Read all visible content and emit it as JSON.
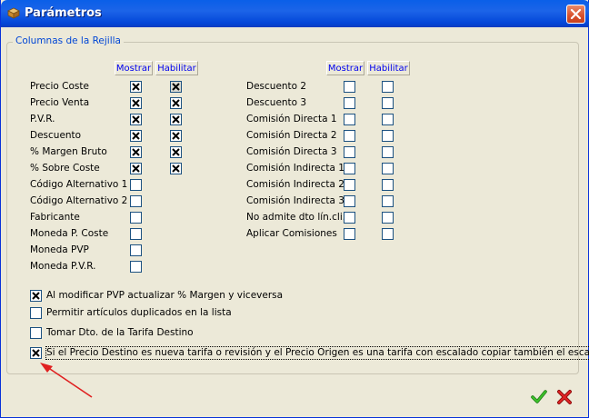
{
  "window": {
    "title": "Parámetros"
  },
  "group": {
    "legend": "Columnas de la Rejilla"
  },
  "left_headers": {
    "show": "Mostrar",
    "enable": "Habilitar"
  },
  "right_headers": {
    "show": "Mostrar",
    "enable": "Habilitar"
  },
  "left_rows": [
    {
      "label": "Precio Coste",
      "show": true,
      "enable": true
    },
    {
      "label": "Precio Venta",
      "show": true,
      "enable": true
    },
    {
      "label": "P.V.R.",
      "show": true,
      "enable": true
    },
    {
      "label": "Descuento",
      "show": true,
      "enable": true
    },
    {
      "label": "% Margen Bruto",
      "show": true,
      "enable": true
    },
    {
      "label": "% Sobre Coste",
      "show": true,
      "enable": true
    },
    {
      "label": "Código Alternativo 1",
      "show": false
    },
    {
      "label": "Código Alternativo 2",
      "show": false
    },
    {
      "label": "Fabricante",
      "show": false
    },
    {
      "label": "Moneda P. Coste",
      "show": false
    },
    {
      "label": "Moneda PVP",
      "show": false
    },
    {
      "label": "Moneda P.V.R.",
      "show": false
    }
  ],
  "right_rows": [
    {
      "label": "Descuento 2",
      "show": false,
      "enable": false
    },
    {
      "label": "Descuento 3",
      "show": false,
      "enable": false
    },
    {
      "label": "Comisión Directa 1",
      "show": false,
      "enable": false
    },
    {
      "label": "Comisión Directa 2",
      "show": false,
      "enable": false
    },
    {
      "label": "Comisión Directa 3",
      "show": false,
      "enable": false
    },
    {
      "label": "Comisión Indirecta 1",
      "show": false,
      "enable": false
    },
    {
      "label": "Comisión Indirecta 2",
      "show": false,
      "enable": false
    },
    {
      "label": "Comisión Indirecta 3",
      "show": false,
      "enable": false
    },
    {
      "label": "No admite dto lín.cli.",
      "show": false,
      "enable": false
    },
    {
      "label": "Aplicar Comisiones",
      "show": false,
      "enable": false
    }
  ],
  "options": [
    {
      "label": "Al modificar PVP actualizar % Margen y viceversa",
      "checked": true
    },
    {
      "label": "Permitir artículos duplicados en la lista",
      "checked": false
    },
    {
      "label": "Tomar Dto. de la Tarifa Destino",
      "checked": false
    },
    {
      "label": "Si el Precio Destino es nueva tarifa o revisión y el Precio Origen es una tarifa con escalado copiar también el escalado",
      "checked": true,
      "focused": true
    }
  ],
  "buttons": {
    "ok_icon": "checkmark-icon",
    "cancel_icon": "x-icon"
  },
  "colors": {
    "title_bar": "#0a5fe8",
    "legend": "#0046d5",
    "header_text": "#0000ee",
    "arrow": "#e02020",
    "ok": "#2a9a1e",
    "cancel": "#d01818"
  }
}
